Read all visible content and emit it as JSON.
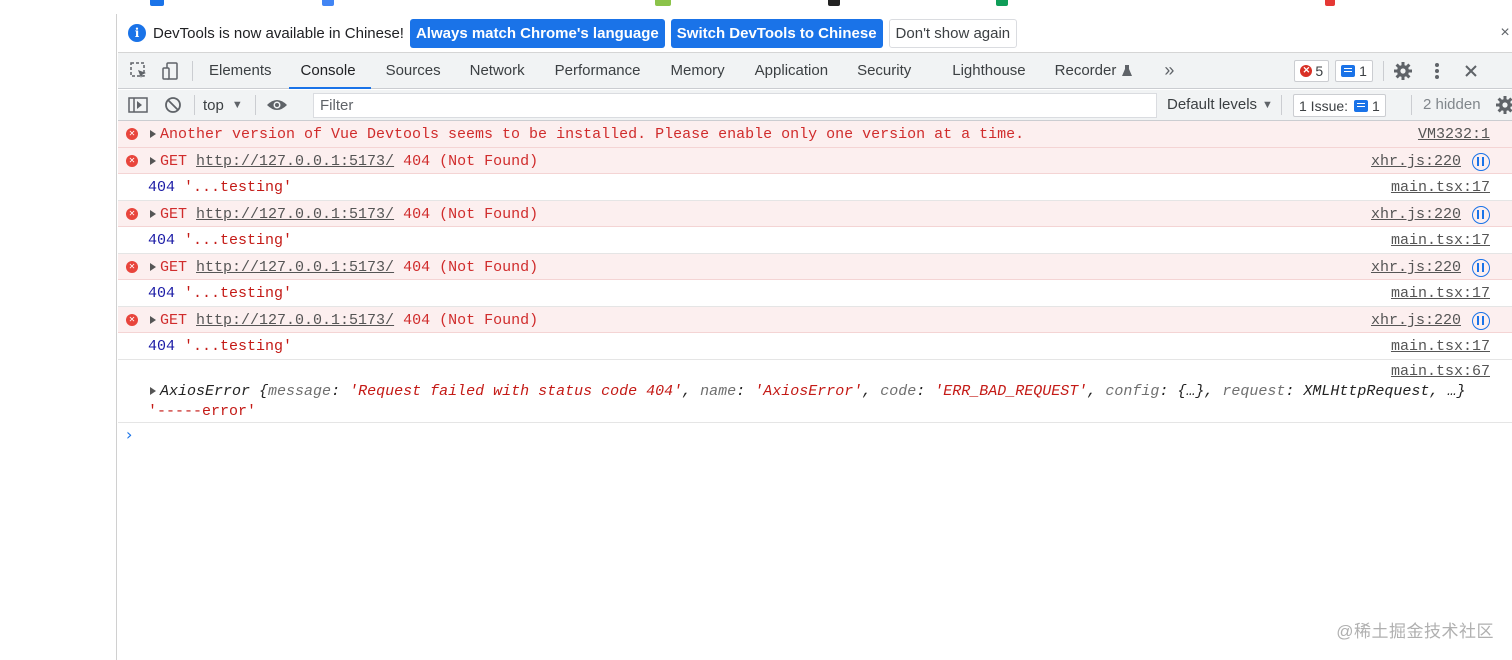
{
  "infobar": {
    "message": "DevTools is now available in Chinese!",
    "btn_match": "Always match Chrome's language",
    "btn_switch": "Switch DevTools to Chinese",
    "btn_dismiss": "Don't show again",
    "close": "×"
  },
  "tabs": [
    {
      "label": "Elements"
    },
    {
      "label": "Console",
      "active": true
    },
    {
      "label": "Sources"
    },
    {
      "label": "Network"
    },
    {
      "label": "Performance"
    },
    {
      "label": "Memory"
    },
    {
      "label": "Application"
    },
    {
      "label": "Security"
    },
    {
      "label": "Lighthouse"
    },
    {
      "label": "Recorder"
    }
  ],
  "toolbar": {
    "more_tabs": "»",
    "error_count": "5",
    "message_count": "1"
  },
  "console_toolbar": {
    "context": "top",
    "filter_placeholder": "Filter",
    "levels": "Default levels",
    "issues_label": "1 Issue:",
    "issues_count": "1",
    "hidden": "2 hidden"
  },
  "messages": [
    {
      "type": "error",
      "text": "Another version of Vue Devtools seems to be installed. Please enable only one version at a time.",
      "source": "VM3232:1"
    },
    {
      "type": "error",
      "method": "GET",
      "url": "http://127.0.0.1:5173/",
      "status": "404 (Not Found)",
      "source": "xhr.js:220"
    },
    {
      "type": "log",
      "num": "404",
      "str": "'...testing'",
      "source": "main.tsx:17"
    },
    {
      "type": "error",
      "method": "GET",
      "url": "http://127.0.0.1:5173/",
      "status": "404 (Not Found)",
      "source": "xhr.js:220"
    },
    {
      "type": "log",
      "num": "404",
      "str": "'...testing'",
      "source": "main.tsx:17"
    },
    {
      "type": "error",
      "method": "GET",
      "url": "http://127.0.0.1:5173/",
      "status": "404 (Not Found)",
      "source": "xhr.js:220"
    },
    {
      "type": "log",
      "num": "404",
      "str": "'...testing'",
      "source": "main.tsx:17"
    },
    {
      "type": "error",
      "method": "GET",
      "url": "http://127.0.0.1:5173/",
      "status": "404 (Not Found)",
      "source": "xhr.js:220"
    },
    {
      "type": "log",
      "num": "404",
      "str": "'...testing'",
      "source": "main.tsx:17"
    }
  ],
  "axios": {
    "source": "main.tsx:67",
    "class": "AxiosError",
    "open": "{",
    "k1": "message",
    "v1": "'Request failed with status code 404'",
    "k2": "name",
    "v2": "'AxiosError'",
    "k3": "code",
    "v3": "'ERR_BAD_REQUEST'",
    "k4": "config",
    "v4": "{…}",
    "k5": "request",
    "v5": "XMLHttpRequest",
    "tail": ", …}",
    "suffix": "'-----error'"
  },
  "prompt": "›",
  "watermark": "@稀土掘金技术社区",
  "colors": {
    "accent": "#1a73e8",
    "error_bg": "#fcefef",
    "error_text": "#d02c2c"
  }
}
